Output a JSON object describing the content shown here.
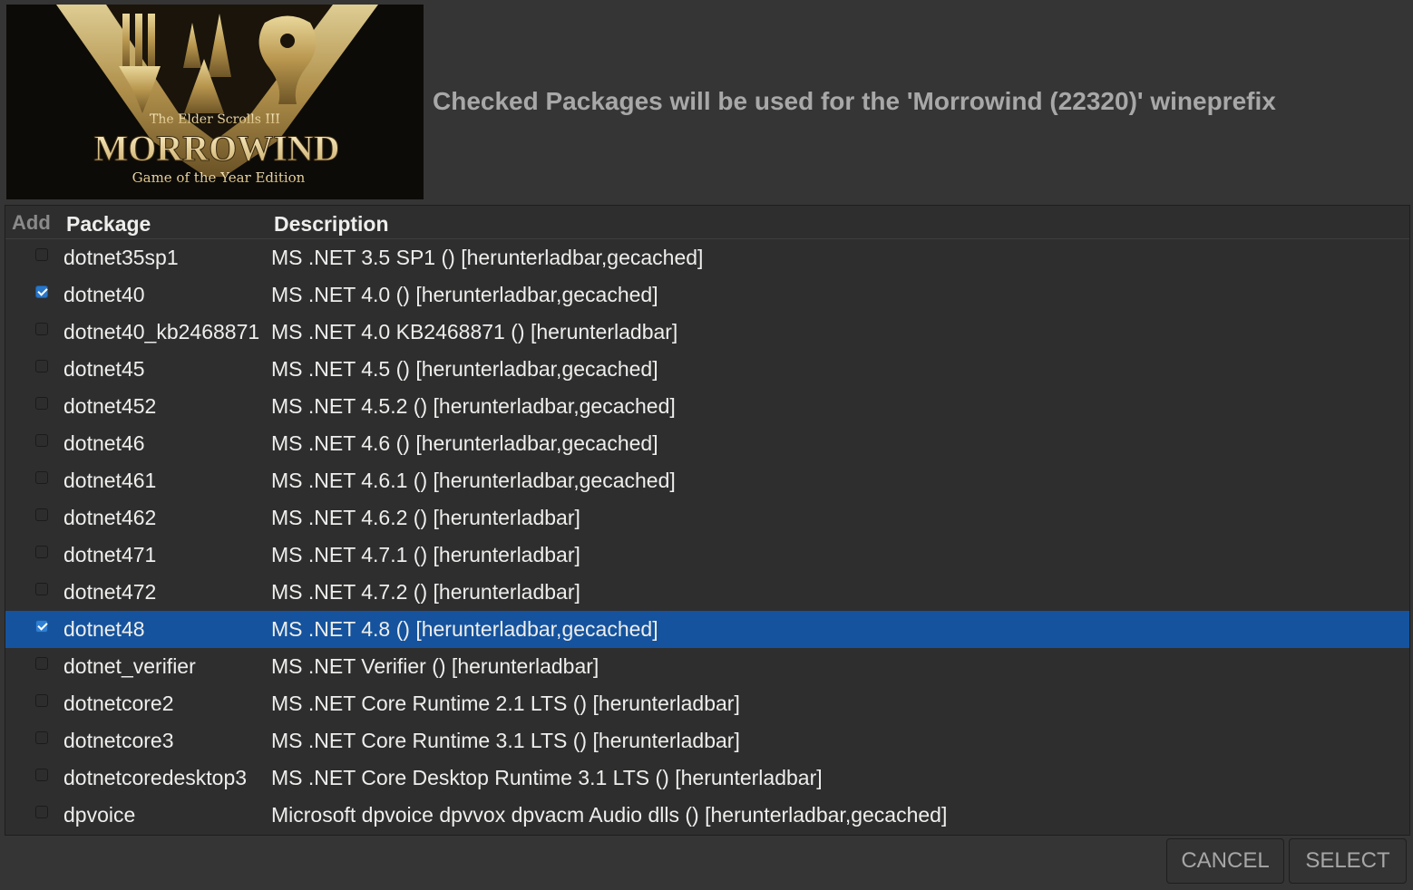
{
  "banner": {
    "line1": "The Elder Scrolls III",
    "line2": "MORROWIND",
    "line3": "Game of the Year Edition"
  },
  "header": {
    "text": "Checked Packages will be used for the 'Morrowind (22320)' wineprefix"
  },
  "columns": {
    "add": "Add",
    "package": "Package",
    "description": "Description"
  },
  "rows": [
    {
      "checked": false,
      "selected": false,
      "package": "dotnet35sp1",
      "description": "MS .NET 3.5 SP1 () [herunterladbar,gecached]"
    },
    {
      "checked": true,
      "selected": false,
      "package": "dotnet40",
      "description": "MS .NET 4.0 () [herunterladbar,gecached]"
    },
    {
      "checked": false,
      "selected": false,
      "package": "dotnet40_kb2468871",
      "description": "MS .NET 4.0 KB2468871 () [herunterladbar]"
    },
    {
      "checked": false,
      "selected": false,
      "package": "dotnet45",
      "description": "MS .NET 4.5 () [herunterladbar,gecached]"
    },
    {
      "checked": false,
      "selected": false,
      "package": "dotnet452",
      "description": "MS .NET 4.5.2 () [herunterladbar,gecached]"
    },
    {
      "checked": false,
      "selected": false,
      "package": "dotnet46",
      "description": "MS .NET 4.6 () [herunterladbar,gecached]"
    },
    {
      "checked": false,
      "selected": false,
      "package": "dotnet461",
      "description": "MS .NET 4.6.1 () [herunterladbar,gecached]"
    },
    {
      "checked": false,
      "selected": false,
      "package": "dotnet462",
      "description": "MS .NET 4.6.2 () [herunterladbar]"
    },
    {
      "checked": false,
      "selected": false,
      "package": "dotnet471",
      "description": "MS .NET 4.7.1 () [herunterladbar]"
    },
    {
      "checked": false,
      "selected": false,
      "package": "dotnet472",
      "description": "MS .NET 4.7.2 () [herunterladbar]"
    },
    {
      "checked": true,
      "selected": true,
      "package": "dotnet48",
      "description": "MS .NET 4.8 () [herunterladbar,gecached]"
    },
    {
      "checked": false,
      "selected": false,
      "package": "dotnet_verifier",
      "description": "MS .NET Verifier () [herunterladbar]"
    },
    {
      "checked": false,
      "selected": false,
      "package": "dotnetcore2",
      "description": "MS .NET Core Runtime 2.1 LTS () [herunterladbar]"
    },
    {
      "checked": false,
      "selected": false,
      "package": "dotnetcore3",
      "description": "MS .NET Core Runtime 3.1 LTS () [herunterladbar]"
    },
    {
      "checked": false,
      "selected": false,
      "package": "dotnetcoredesktop3",
      "description": "MS .NET Core Desktop Runtime 3.1 LTS () [herunterladbar]"
    },
    {
      "checked": false,
      "selected": false,
      "package": "dpvoice",
      "description": "Microsoft dpvoice dpvvox dpvacm Audio dlls () [herunterladbar,gecached]"
    }
  ],
  "buttons": {
    "cancel": "CANCEL",
    "select": "SELECT"
  },
  "colors": {
    "background": "#353535",
    "list_background": "#2e2e2e",
    "selection": "#15539e",
    "check_accent": "#2a76c6"
  }
}
